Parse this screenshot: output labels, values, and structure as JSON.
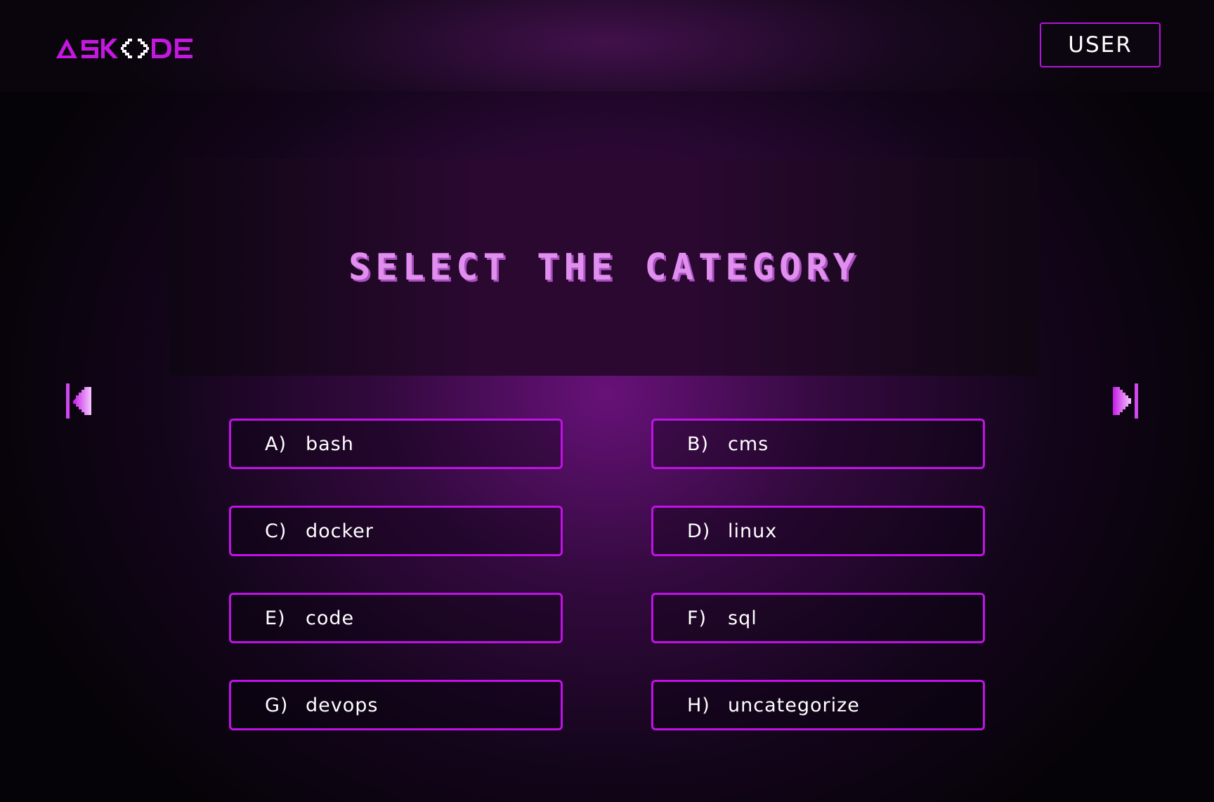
{
  "header": {
    "logo_text": "ASKODE",
    "user_button_label": "USER"
  },
  "banner": {
    "title": "SELECT THE CATEGORY"
  },
  "navigation": {
    "prev_icon": "skip-previous-icon",
    "next_icon": "skip-next-icon"
  },
  "categories": [
    {
      "letter": "A)",
      "label": "bash"
    },
    {
      "letter": "B)",
      "label": "cms"
    },
    {
      "letter": "C)",
      "label": "docker"
    },
    {
      "letter": "D)",
      "label": "linux"
    },
    {
      "letter": "E)",
      "label": "code"
    },
    {
      "letter": "F)",
      "label": "sql"
    },
    {
      "letter": "G)",
      "label": "devops"
    },
    {
      "letter": "H)",
      "label": "uncategorize"
    }
  ],
  "colors": {
    "accent": "#c012e6",
    "title_text": "#e08fee",
    "text": "#ffffff",
    "background": "#07040a"
  }
}
